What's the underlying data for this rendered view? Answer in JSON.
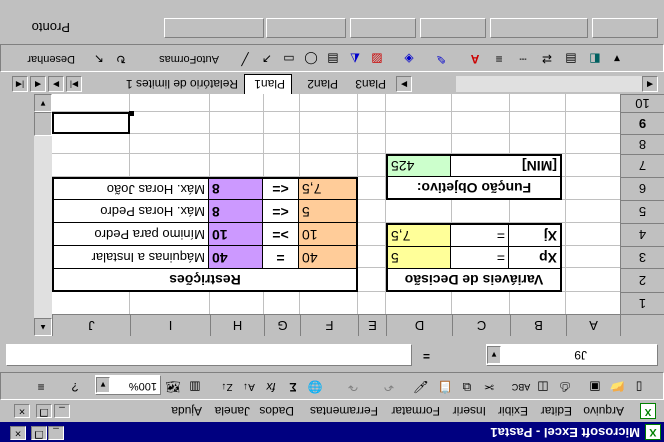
{
  "window": {
    "title": "Microsoft Excel - Pasta1"
  },
  "menu": [
    "Arquivo",
    "Editar",
    "Exibir",
    "Inserir",
    "Formatar",
    "Ferramentas",
    "Dados",
    "Janela",
    "Ajuda"
  ],
  "toolbar": {
    "zoom": "100%"
  },
  "formula_bar": {
    "name_box": "J9",
    "equals": "=",
    "value": ""
  },
  "columns": [
    "A",
    "B",
    "C",
    "D",
    "E",
    "F",
    "G",
    "H",
    "I",
    "J"
  ],
  "rows": [
    "1",
    "2",
    "3",
    "4",
    "5",
    "6",
    "7",
    "8",
    "9",
    "10"
  ],
  "active_cell": "J9",
  "cells": {
    "B2": "Variáveis de Decisão",
    "B3": "Xp",
    "C3": "=",
    "D3": "5",
    "B4": "Xj",
    "C4": "=",
    "D4": "7,5",
    "B6": "Função Objetivo:",
    "B7": "[MIN]",
    "D7": "425",
    "F2": "Restrições",
    "F3": "40",
    "G3": "=",
    "H3": "40",
    "I3": "Máquinas a Instalar",
    "F4": "10",
    "G4": ">=",
    "H4": "10",
    "I4": "Mínimo para Pedro",
    "F5": "5",
    "G5": "<=",
    "H5": "8",
    "I5": "Máx. Horas Pedro",
    "F6": "7,5",
    "G6": "<=",
    "H6": "8",
    "I6": "Máx. Horas João"
  },
  "sheet_tabs": [
    "Relatório de limites 1",
    "Plan1",
    "Plan2",
    "Plan3"
  ],
  "active_sheet": "Plan1",
  "drawing_toolbar": {
    "draw_label": "Desenhar",
    "autoshapes_label": "AutoFormas"
  },
  "status": {
    "text": "Pronto"
  },
  "colors": {
    "title_bar": "#000080",
    "orange": "#ffcc99",
    "purple": "#cc99ff",
    "yellow": "#ffff99",
    "green": "#ccffcc"
  },
  "icons": [
    "excel-icon",
    "minimize-icon",
    "restore-icon",
    "close-icon",
    "new-icon",
    "open-icon",
    "save-icon",
    "print-icon",
    "preview-icon",
    "spelling-icon",
    "cut-icon",
    "copy-icon",
    "paste-icon",
    "format-painter-icon",
    "undo-icon",
    "redo-icon",
    "hyperlink-icon",
    "autosum-icon",
    "function-icon",
    "sort-asc-icon",
    "sort-desc-icon",
    "chart-wizard-icon",
    "map-icon",
    "drawing-icon",
    "help-icon"
  ]
}
